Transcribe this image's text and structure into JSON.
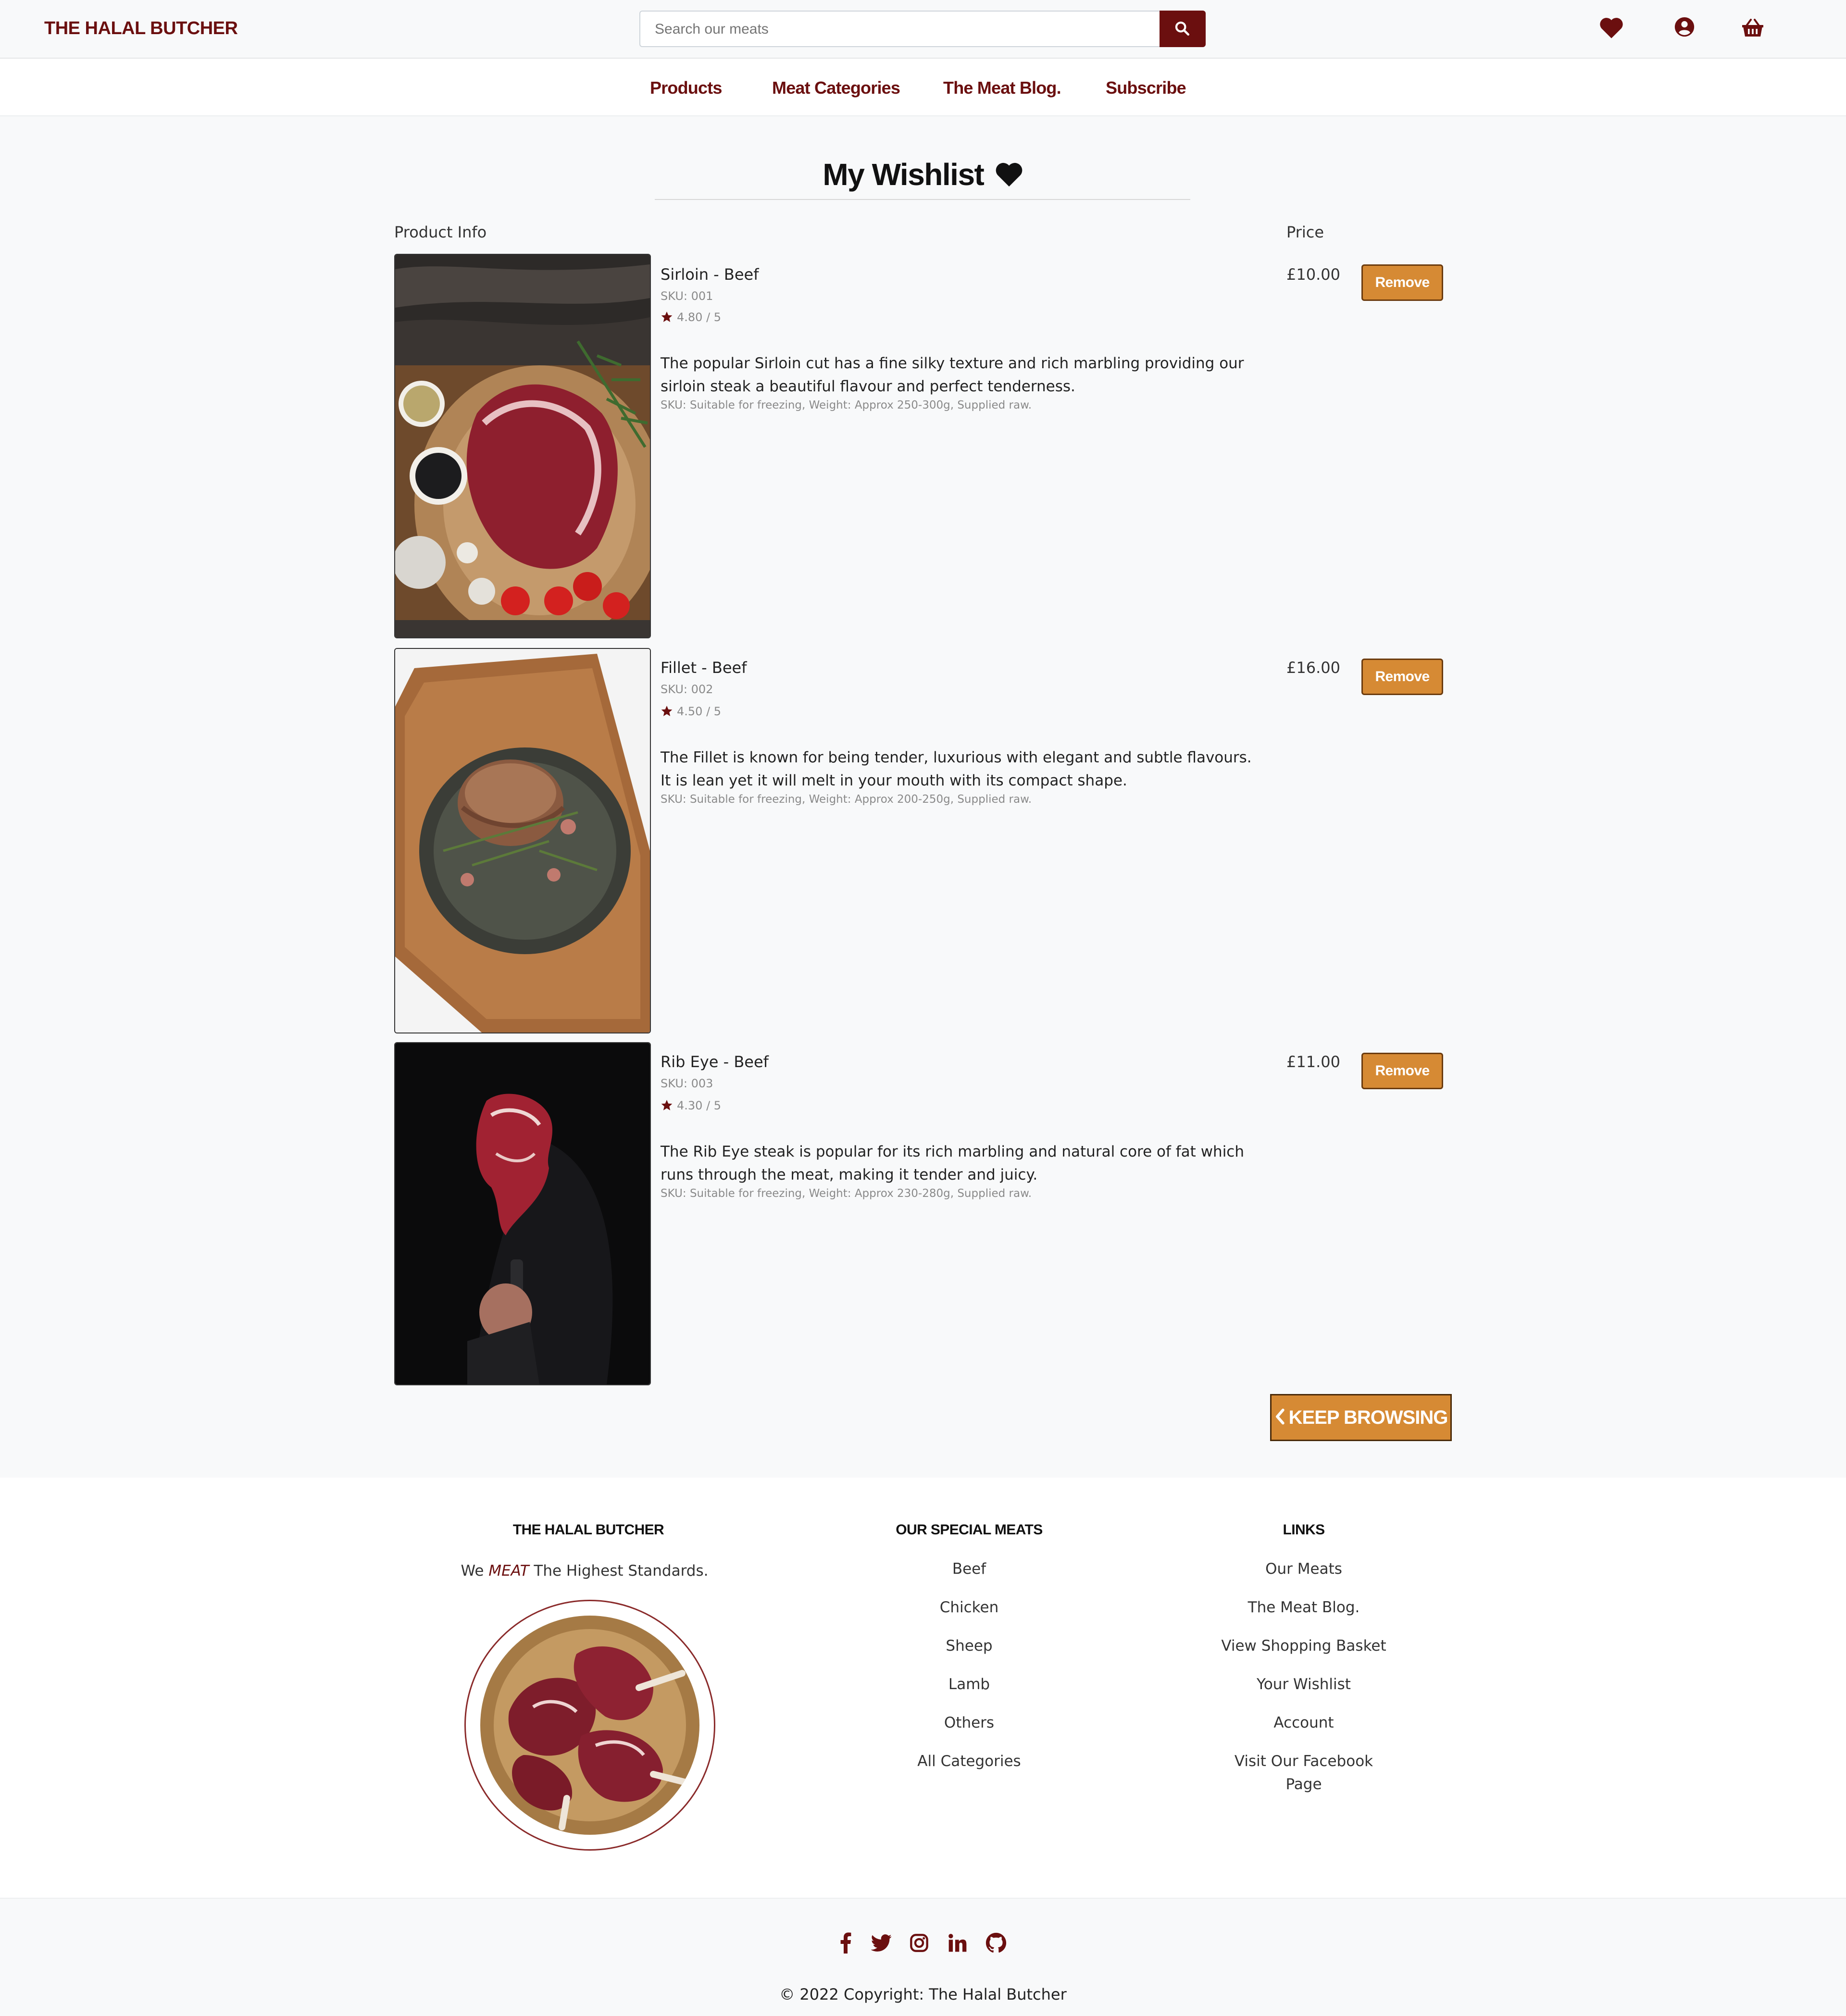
{
  "brand": "THE HALAL BUTCHER",
  "search": {
    "placeholder": "Search our meats"
  },
  "nav": [
    "Products",
    "Meat Categories",
    "The Meat Blog.",
    "Subscribe"
  ],
  "page": {
    "title": "My Wishlist",
    "col_product": "Product Info",
    "col_price": "Price",
    "keep_browsing": "KEEP BROWSING"
  },
  "products": [
    {
      "name": "Sirloin - Beef",
      "sku": "SKU: 001",
      "rating": "4.80 / 5",
      "description": "The popular Sirloin cut has a fine silky texture and rich marbling providing our sirloin steak a beautiful flavour and perfect tenderness.",
      "meta": "SKU: Suitable for freezing, Weight: Approx 250-300g, Supplied raw.",
      "price": "£10.00",
      "remove": "Remove"
    },
    {
      "name": "Fillet - Beef",
      "sku": "SKU: 002",
      "rating": "4.50 / 5",
      "description": "The Fillet is known for being tender, luxurious with elegant and subtle flavours. It is lean yet it will melt in your mouth with its compact shape.",
      "meta": "SKU: Suitable for freezing, Weight: Approx 200-250g, Supplied raw.",
      "price": "£16.00",
      "remove": "Remove"
    },
    {
      "name": "Rib Eye - Beef",
      "sku": "SKU: 003",
      "rating": "4.30 / 5",
      "description": "The Rib Eye steak is popular for its rich marbling and natural core of fat which runs through the meat, making it tender and juicy.",
      "meta": "SKU: Suitable for freezing, Weight: Approx 230-280g, Supplied raw.",
      "price": "£11.00",
      "remove": "Remove"
    }
  ],
  "footer": {
    "col1_title": "THE HALAL BUTCHER",
    "tagline_pre": "We",
    "tagline_em": "MEAT",
    "tagline_post": "The Highest Standards.",
    "col2_title": "OUR SPECIAL MEATS",
    "col2_links": [
      "Beef",
      "Chicken",
      "Sheep",
      "Lamb",
      "Others",
      "All Categories"
    ],
    "col3_title": "LINKS",
    "col3_links": [
      "Our Meats",
      "The Meat Blog.",
      "View Shopping Basket",
      "Your Wishlist",
      "Account",
      "Visit Our Facebook Page"
    ]
  },
  "copyright": "© 2022 Copyright: The Halal Butcher",
  "icons": [
    "heart-icon",
    "user-circle-icon",
    "basket-icon",
    "search-icon",
    "star-icon",
    "chevron-left-icon",
    "facebook-icon",
    "twitter-icon",
    "instagram-icon",
    "linkedin-icon",
    "github-icon"
  ],
  "colors": {
    "brand": "#6b0f0f",
    "accent": "#d68a34",
    "background": "#f8f9fa"
  }
}
